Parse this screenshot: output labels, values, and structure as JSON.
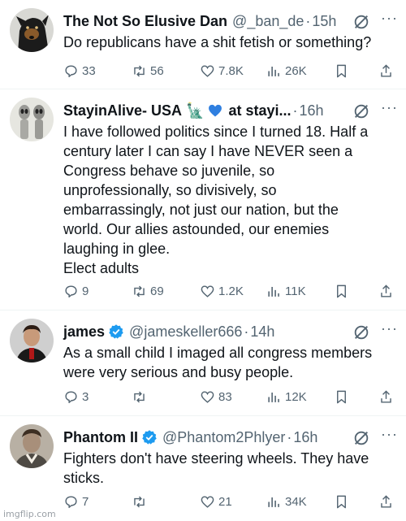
{
  "colors": {
    "text_primary": "#0f1419",
    "text_secondary": "#536471",
    "verified_blue": "#1d9bf0",
    "heart_emoji_blue": "#2f7fe0"
  },
  "tweets": [
    {
      "name": "The Not So Elusive Dan",
      "handle": "@_ban_de",
      "time": "15h",
      "verified": false,
      "text": "Do republicans have a shit fetish or something?",
      "replies": "33",
      "retweets": "56",
      "likes": "7.8K",
      "views": "26K",
      "avatar_icon": "dog-avatar"
    },
    {
      "name": "StayinAlive- USA",
      "name_emoji": "🗽",
      "handle": "at stayi...",
      "time": "16h",
      "verified": false,
      "text": "I have followed politics since I turned 18. Half a\ncentury later I can say I have NEVER seen a\nCongress behave so juvenile, so\nunprofessionally, so divisively, so\nembarrassingly, not just our nation, but the\nworld. Our allies astounded, our enemies\nlaughing in glee.\nElect adults",
      "replies": "9",
      "retweets": "69",
      "likes": "1.2K",
      "views": "11K",
      "avatar_icon": "aliens-avatar"
    },
    {
      "name": "james",
      "handle": "@jameskeller666",
      "time": "14h",
      "verified": true,
      "text": "As a small child I imaged all congress members\nwere very serious and busy people.",
      "replies": "3",
      "retweets": "",
      "likes": "83",
      "views": "12K",
      "avatar_icon": "person-avatar"
    },
    {
      "name": "Phantom II",
      "handle": "@Phantom2Phlyer",
      "time": "16h",
      "verified": true,
      "text": "Fighters don't have steering wheels. They have\nsticks.",
      "replies": "7",
      "retweets": "",
      "likes": "21",
      "views": "34K",
      "avatar_icon": "soldier-avatar"
    }
  ],
  "separator": "·",
  "more_glyph": "···",
  "watermark": "imgflip.com"
}
